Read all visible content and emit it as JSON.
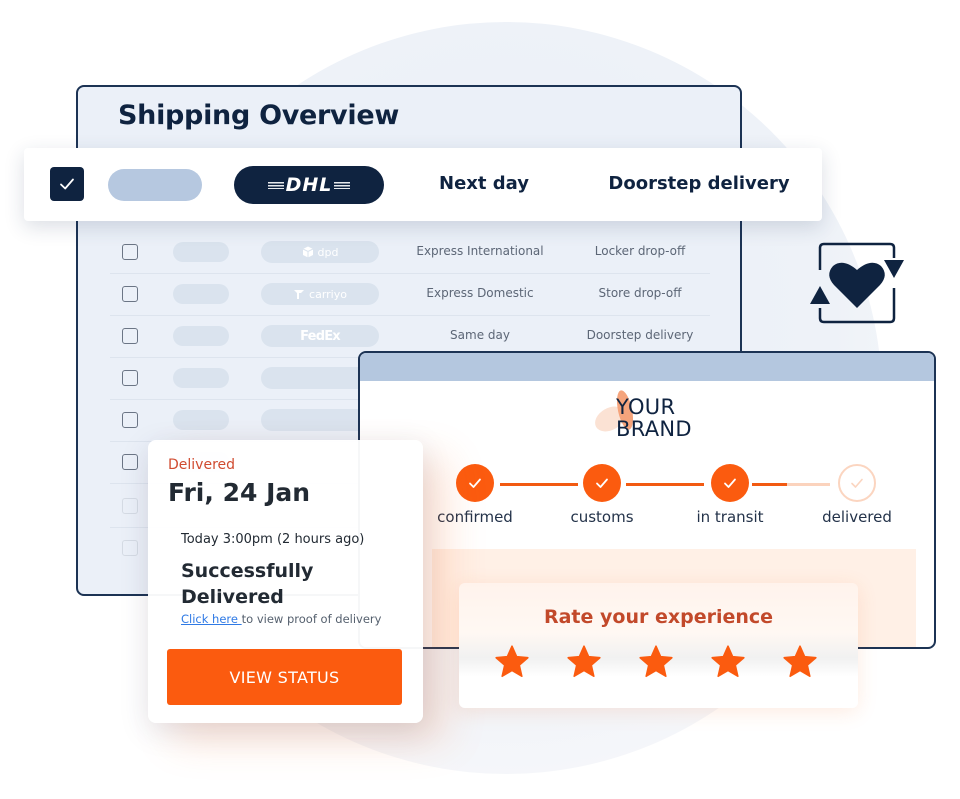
{
  "overview": {
    "title": "Shipping Overview",
    "highlighted_row": {
      "checked": true,
      "carrier": "DHL",
      "service": "Next day",
      "method": "Doorstep delivery"
    },
    "rows": [
      {
        "carrier": "dpd",
        "carrier_icon": "cube-icon",
        "service": "Express International",
        "method": "Locker drop-off"
      },
      {
        "carrier": "carriyo",
        "carrier_icon": "carriyo-logo-icon",
        "service": "Express Domestic",
        "method": "Store drop-off"
      },
      {
        "carrier": "FedEx",
        "carrier_icon": "",
        "service": "Same day",
        "method": "Doorstep delivery"
      },
      {
        "carrier": "",
        "service": "",
        "method": ""
      },
      {
        "carrier": "",
        "service": "",
        "method": ""
      },
      {
        "carrier": "",
        "service": "",
        "method": ""
      },
      {
        "carrier": "",
        "service": "",
        "method": ""
      },
      {
        "carrier": "",
        "service": "",
        "method": ""
      }
    ]
  },
  "loyalty_icon": "heart-refresh-icon",
  "tracking": {
    "brand_line1": "YOUR",
    "brand_line2": "BRAND",
    "steps": [
      {
        "label": "confirmed",
        "done": true
      },
      {
        "label": "customs",
        "done": true
      },
      {
        "label": "in transit",
        "done": true
      },
      {
        "label": "delivered",
        "done": false
      }
    ]
  },
  "delivery_card": {
    "status": "Delivered",
    "date": "Fri, 24 Jan",
    "time": "Today 3:00pm (2 hours ago)",
    "headline": "Successfully Delivered",
    "link_text": "Click here ",
    "link_suffix": "to view proof of delivery",
    "button_label": "VIEW STATUS"
  },
  "rating": {
    "title": "Rate your experience",
    "stars_filled": 5,
    "stars_total": 5
  },
  "colors": {
    "accent": "#fb5b0f",
    "navy": "#0f2340",
    "panel_bg": "#ebf0f8",
    "header_bar": "#b4c7df",
    "link": "#2f7ae5",
    "status_text": "#d04b30"
  }
}
